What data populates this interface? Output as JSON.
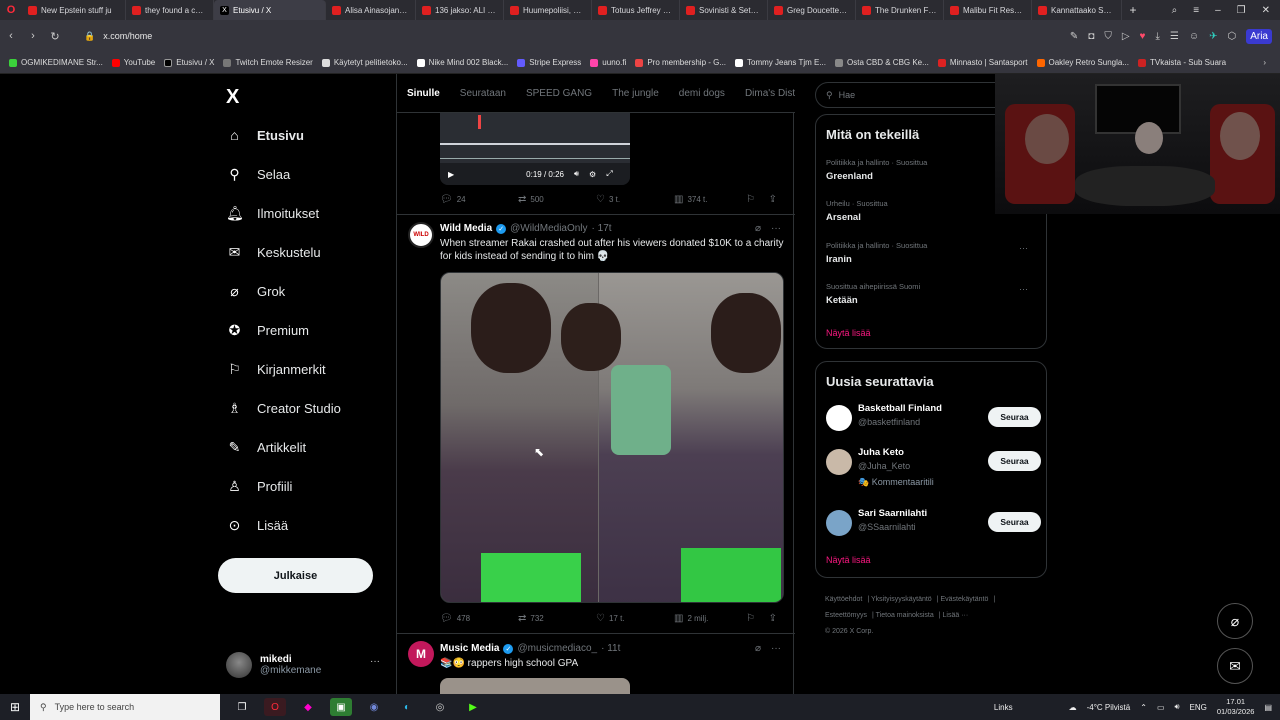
{
  "browser": {
    "tabs": [
      {
        "title": "New Epstein stuff ju",
        "active": false
      },
      {
        "title": "they found a conta",
        "active": false
      },
      {
        "title": "Etusivu / X",
        "active": true
      },
      {
        "title": "Alisa Ainasojan Toi",
        "active": false
      },
      {
        "title": "136 jakso: ALI KHA",
        "active": false
      },
      {
        "title": "Huumepoliisi, Riko",
        "active": false
      },
      {
        "title": "Totuus Jeffrey Epste",
        "active": false
      },
      {
        "title": "Sovinisti & Setämie",
        "active": false
      },
      {
        "title": "Greg Doucette - Yo",
        "active": false
      },
      {
        "title": "The Drunken Fall of",
        "active": false
      },
      {
        "title": "Malibu Fit Respond",
        "active": false
      },
      {
        "title": "Kannattaako Screa",
        "active": false
      }
    ],
    "url": "x.com/home",
    "aria_label": "Aria",
    "bookmarks": [
      "OGMIKEDIMANE Str...",
      "YouTube",
      "Etusivu / X",
      "Twitch Emote Resizer",
      "Käytetyt pelitietoko...",
      "Nike Mind 002 Black...",
      "Stripe Express",
      "uuno.fi",
      "Pro membership - G...",
      "Tommy Jeans Tjm E...",
      "Osta CBD & CBG Ke...",
      "Minnasto | Santasport",
      "Oakley Retro Sungla...",
      "TVkaista - Sub Suara"
    ]
  },
  "sidebar": {
    "logo": "X",
    "items": [
      {
        "label": "Etusivu",
        "icon": "home-icon"
      },
      {
        "label": "Selaa",
        "icon": "search-icon"
      },
      {
        "label": "Ilmoitukset",
        "icon": "bell-icon"
      },
      {
        "label": "Keskustelu",
        "icon": "mail-icon"
      },
      {
        "label": "Grok",
        "icon": "grok-icon"
      },
      {
        "label": "Premium",
        "icon": "premium-icon"
      },
      {
        "label": "Kirjanmerkit",
        "icon": "bookmark-icon"
      },
      {
        "label": "Creator Studio",
        "icon": "creator-icon"
      },
      {
        "label": "Artikkelit",
        "icon": "article-icon"
      },
      {
        "label": "Profiili",
        "icon": "profile-icon"
      },
      {
        "label": "Lisää",
        "icon": "more-icon"
      }
    ],
    "post_button": "Julkaise",
    "profile": {
      "name": "mikedi",
      "handle": "@mikkemane"
    }
  },
  "timeline": {
    "tabs": [
      "Sinulle",
      "Seurataan",
      "SPEED GANG",
      "The jungle",
      "demi dogs",
      "Dima's Disti"
    ],
    "prev_video": {
      "time": "0:19 / 0:26"
    },
    "prev_actions": {
      "replies": "24",
      "reposts": "500",
      "likes": "3 t.",
      "views": "374 t."
    },
    "post1": {
      "name": "Wild Media",
      "handle": "@WildMediaOnly",
      "time": "· 17t",
      "text": "When streamer Rakai crashed out after his viewers donated $10K to a charity for kids instead of sending it to him 💀",
      "actions": {
        "replies": "478",
        "reposts": "732",
        "likes": "17 t.",
        "views": "2 milj."
      }
    },
    "post2": {
      "name": "Music Media",
      "handle": "@musicmediaco_",
      "time": "· 11t",
      "text": "📚😳 rappers high school GPA"
    }
  },
  "right": {
    "search_placeholder": "Hae",
    "trends_title": "Mitä on tekeillä",
    "trends": [
      {
        "category": "Politiikka ja hallinto · Suosittua",
        "name": "Greenland"
      },
      {
        "category": "Urheilu · Suosittua",
        "name": "Arsenal"
      },
      {
        "category": "Politiikka ja hallinto · Suosittua",
        "name": "Iranin"
      },
      {
        "category": "Suosittua aihepiirissä Suomi",
        "name": "Ketään"
      }
    ],
    "show_more": "Näytä lisää",
    "follow_title": "Uusia seurattavia",
    "follow": [
      {
        "name": "Basketball Finland",
        "handle": "@basketfinland",
        "extra": "",
        "button": "Seuraa"
      },
      {
        "name": "Juha Keto",
        "handle": "@Juha_Keto",
        "extra": "🎭 Kommentaaritili",
        "button": "Seuraa"
      },
      {
        "name": "Sari Saarnilahti",
        "handle": "@SSaarnilahti",
        "extra": "",
        "button": "Seuraa"
      }
    ],
    "follow_more": "Näytä lisää",
    "footer": [
      "Käyttöehdot",
      "Yksityisyyskäytäntö",
      "Evästekäytäntö",
      "Esteettömyys",
      "Tietoa mainoksista",
      "Lisää ···",
      "© 2026 X Corp."
    ]
  },
  "taskbar": {
    "search_placeholder": "Type here to search",
    "links": "Links",
    "weather": "-4°C  Pilvistä",
    "lang": "ENG",
    "time": "17.01",
    "date": "01/03/2026"
  },
  "colors": {
    "accent": "#1d9bf0",
    "pink": "#f91880",
    "bg": "#000000"
  }
}
